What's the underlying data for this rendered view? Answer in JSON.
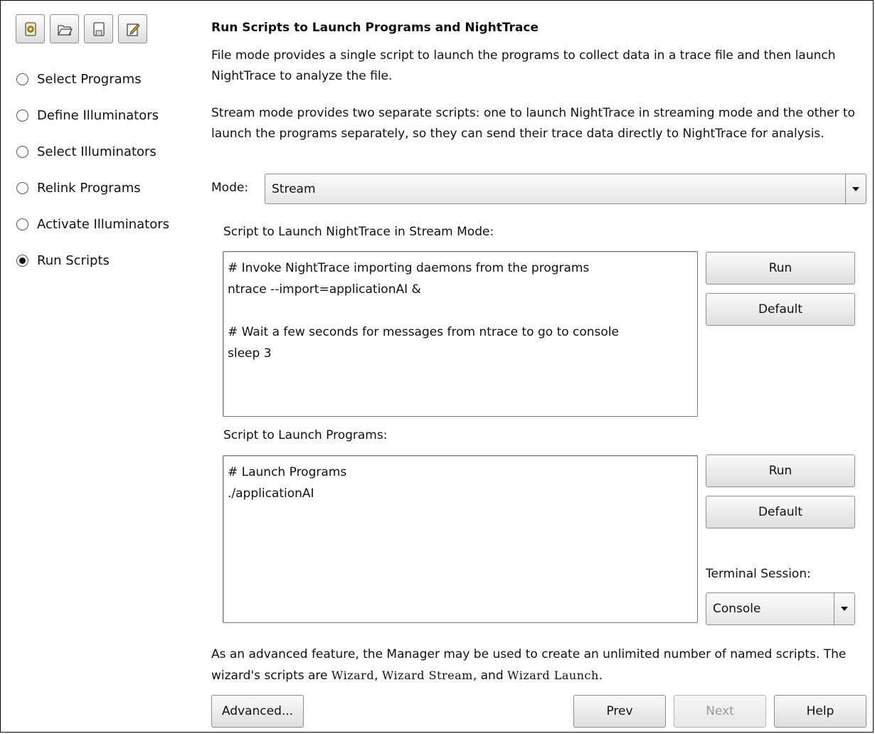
{
  "toolbar": {
    "buttons": [
      {
        "icon": "wizard-gear-icon"
      },
      {
        "icon": "open-folder-icon"
      },
      {
        "icon": "save-disk-icon"
      },
      {
        "icon": "edit-pencil-icon"
      }
    ]
  },
  "steps": [
    {
      "label": "Select Programs",
      "selected": false
    },
    {
      "label": "Define Illuminators",
      "selected": false
    },
    {
      "label": "Select Illuminators",
      "selected": false
    },
    {
      "label": "Relink Programs",
      "selected": false
    },
    {
      "label": "Activate Illuminators",
      "selected": false
    },
    {
      "label": "Run Scripts",
      "selected": true
    }
  ],
  "main": {
    "title": "Run Scripts to Launch Programs and NightTrace",
    "file_mode_text": "File mode provides a single script to launch the programs to collect data in a trace file and then launch NightTrace to analyze the file.",
    "stream_mode_text": "Stream mode provides two separate scripts: one to launch NightTrace in streaming mode and the other to launch the programs separately, so they can send their trace data directly to NightTrace for analysis.",
    "mode_label": "Mode:",
    "mode_value": "Stream",
    "stream_script_label": "Script to Launch NightTrace in Stream Mode:",
    "stream_script": "# Invoke NightTrace importing daemons from the programs\nntrace --import=applicationAI &\n\n# Wait a few seconds for messages from ntrace to go to console\nsleep 3",
    "launch_script_label": "Script to Launch Programs:",
    "launch_script": "# Launch Programs\n./applicationAI",
    "run_label": "Run",
    "default_label": "Default",
    "terminal_label": "Terminal Session:",
    "terminal_value": "Console",
    "advanced_text_1": "As an advanced feature, the Manager may be used to create an unlimited number of named scripts. The wizard's scripts are ",
    "script_name_1": "Wizard",
    "sep_1": ", ",
    "script_name_2": "Wizard Stream",
    "sep_2": ", and ",
    "script_name_3": "Wizard Launch",
    "end_punct": "."
  },
  "footer": {
    "advanced_label": "Advanced...",
    "prev_label": "Prev",
    "next_label": "Next",
    "help_label": "Help"
  }
}
